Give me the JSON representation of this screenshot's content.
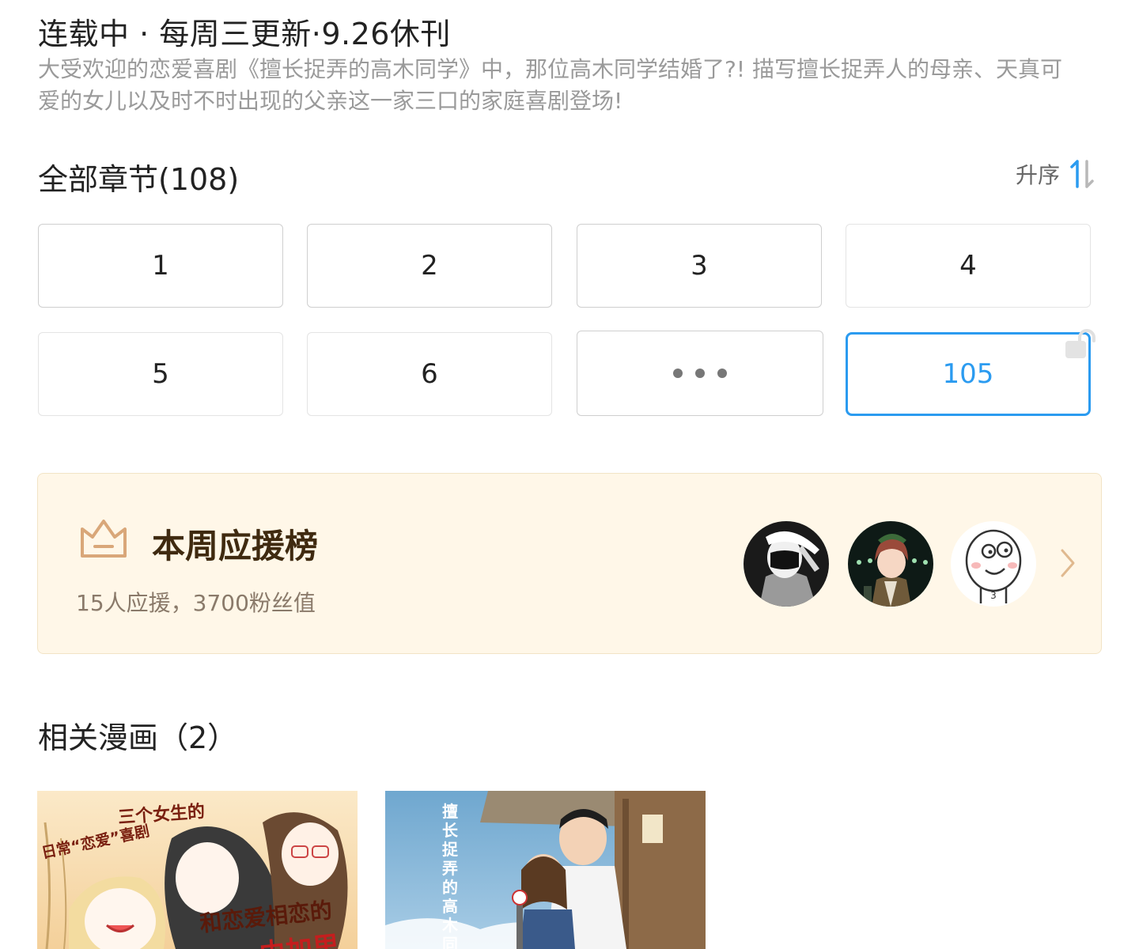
{
  "info": {
    "status": "连载中 · 每周三更新·9.26休刊",
    "summary": "大受欢迎的恋爱喜剧《擅长捉弄的高木同学》中，那位高木同学结婚了?! 描写擅长捉弄人的母亲、天真可爱的女儿以及时不时出现的父亲这一家三口的家庭喜剧登场!"
  },
  "chapters": {
    "title": "全部章节(108)",
    "sort_label": "升序",
    "items": [
      "1",
      "2",
      "3",
      "4",
      "5",
      "6",
      "105"
    ],
    "active_item": "105"
  },
  "support": {
    "title": "本周应援榜",
    "stats": "15人应援，3700粉丝值",
    "avatar_count": 3
  },
  "related": {
    "title": "相关漫画（2）",
    "covers": [
      {
        "lines": [
          "三个女生的",
          "日常“恋爱”喜剧",
          "和恋爱相恋的",
          "由加里"
        ]
      },
      {
        "vertical_title": "擅长捉弄的高木同学"
      }
    ]
  },
  "colors": {
    "accent": "#2b9bf0",
    "card_bg": "#fff7e8",
    "crown": "#d9a779",
    "support_title": "#3f2a10"
  },
  "icons": {
    "sort": "sort-ascending-icon",
    "lock": "unlock-icon",
    "crown": "crown-icon",
    "chevron": "chevron-right-icon"
  }
}
